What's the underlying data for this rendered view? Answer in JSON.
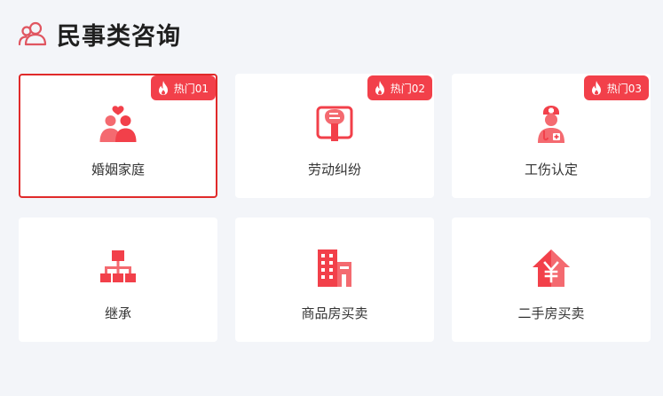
{
  "header": {
    "title": "民事类咨询",
    "icon": "people-icon"
  },
  "cards": [
    {
      "label": "婚姻家庭",
      "badge": "热门01",
      "icon": "couple-heart-icon",
      "active": true
    },
    {
      "label": "劳动纠纷",
      "badge": "热门02",
      "icon": "fist-icon",
      "active": false
    },
    {
      "label": "工伤认定",
      "badge": "热门03",
      "icon": "nurse-icon",
      "active": false
    },
    {
      "label": "继承",
      "icon": "family-tree-icon",
      "active": false
    },
    {
      "label": "商品房买卖",
      "icon": "building-icon",
      "active": false
    },
    {
      "label": "二手房买卖",
      "icon": "house-yuan-icon",
      "active": false
    }
  ],
  "colors": {
    "accent": "#f2404a",
    "active_border": "#e02a2a",
    "background": "#f3f5f9",
    "card": "#ffffff"
  }
}
